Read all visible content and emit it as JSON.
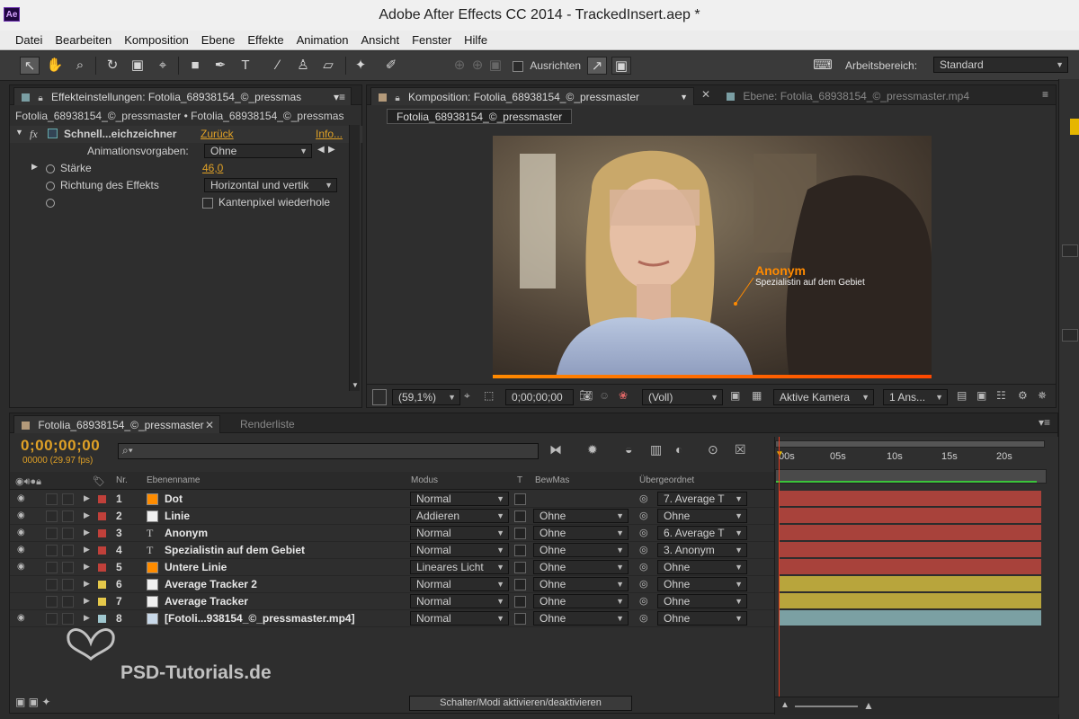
{
  "window": {
    "title": "Adobe After Effects CC 2014 - TrackedInsert.aep *",
    "app_icon": "Ae"
  },
  "menu": [
    "Datei",
    "Bearbeiten",
    "Komposition",
    "Ebene",
    "Effekte",
    "Animation",
    "Ansicht",
    "Fenster",
    "Hilfe"
  ],
  "toolbar": {
    "snap_label": "Ausrichten",
    "workspace_label": "Arbeitsbereich:",
    "workspace_value": "Standard"
  },
  "effects_panel": {
    "tab": "Effekteinstellungen: Fotolia_68938154_©_pressmas",
    "subtitle": "Fotolia_68938154_©_pressmaster • Fotolia_68938154_©_pressmas",
    "effect_name": "Schnell...eichzeichner",
    "reset": "Zurück",
    "info": "Info...",
    "presets_label": "Animationsvorgaben:",
    "presets_value": "Ohne",
    "strength_label": "Stärke",
    "strength_value": "46,0",
    "direction_label": "Richtung des Effekts",
    "direction_value": "Horizontal und vertik",
    "repeat_label": "Kantenpixel wiederhole"
  },
  "comp_panel": {
    "tab": "Komposition: Fotolia_68938154_©_pressmaster",
    "layer_tab": "Ebene: Fotolia_68938154_©_pressmaster.mp4",
    "comp_name": "Fotolia_68938154_©_pressmaster",
    "overlay_title": "Anonym",
    "overlay_subtitle": "Spezialistin auf dem Gebiet",
    "zoom": "(59,1%)",
    "timecode": "0;00;00;00",
    "resolution": "(Voll)",
    "camera": "Aktive Kamera",
    "views": "1 Ans..."
  },
  "timeline": {
    "tab": "Fotolia_68938154_©_pressmaster",
    "render_tab": "Renderliste",
    "timecode": "0;00;00;00",
    "fps": "00000 (29.97 fps)",
    "headers": {
      "nr": "Nr.",
      "name": "Ebenenname",
      "mode": "Modus",
      "t": "T",
      "matte": "BewMas",
      "parent": "Übergeordnet"
    },
    "ruler": [
      "00s",
      "05s",
      "10s",
      "15s",
      "20s"
    ],
    "toggle_button": "Schalter/Modi aktivieren/deaktivieren",
    "layers": [
      {
        "nr": "1",
        "name": "Dot",
        "mode": "Normal",
        "matte": "",
        "parent": "7. Average T",
        "label_color": "#c0403a",
        "src": "solid-orange",
        "visible": true,
        "bar_color": "#a8423b"
      },
      {
        "nr": "2",
        "name": "Linie",
        "mode": "Addieren",
        "matte": "Ohne",
        "parent": "Ohne",
        "label_color": "#c0403a",
        "src": "solid-white",
        "visible": true,
        "bar_color": "#a8423b"
      },
      {
        "nr": "3",
        "name": "Anonym",
        "mode": "Normal",
        "matte": "Ohne",
        "parent": "6. Average T",
        "label_color": "#c0403a",
        "src": "text",
        "visible": true,
        "bar_color": "#a8423b"
      },
      {
        "nr": "4",
        "name": "Spezialistin auf dem Gebiet",
        "mode": "Normal",
        "matte": "Ohne",
        "parent": "3. Anonym",
        "label_color": "#c0403a",
        "src": "text",
        "visible": true,
        "bar_color": "#a8423b"
      },
      {
        "nr": "5",
        "name": "Untere Linie",
        "mode": "Lineares Licht",
        "matte": "Ohne",
        "parent": "Ohne",
        "label_color": "#c0403a",
        "src": "solid-orange",
        "visible": true,
        "bar_color": "#a8423b"
      },
      {
        "nr": "6",
        "name": "Average Tracker 2",
        "mode": "Normal",
        "matte": "Ohne",
        "parent": "Ohne",
        "label_color": "#e5c84a",
        "src": "solid-white",
        "visible": false,
        "bar_color": "#b8a53c"
      },
      {
        "nr": "7",
        "name": "Average Tracker",
        "mode": "Normal",
        "matte": "Ohne",
        "parent": "Ohne",
        "label_color": "#e5c84a",
        "src": "solid-white",
        "visible": false,
        "bar_color": "#b8a53c"
      },
      {
        "nr": "8",
        "name": "[Fotoli...938154_©_pressmaster.mp4]",
        "mode": "Normal",
        "matte": "Ohne",
        "parent": "Ohne",
        "label_color": "#9fc7cf",
        "src": "footage",
        "visible": true,
        "bar_color": "#7ba0a3"
      }
    ]
  },
  "watermark": "PSD-Tutorials.de"
}
